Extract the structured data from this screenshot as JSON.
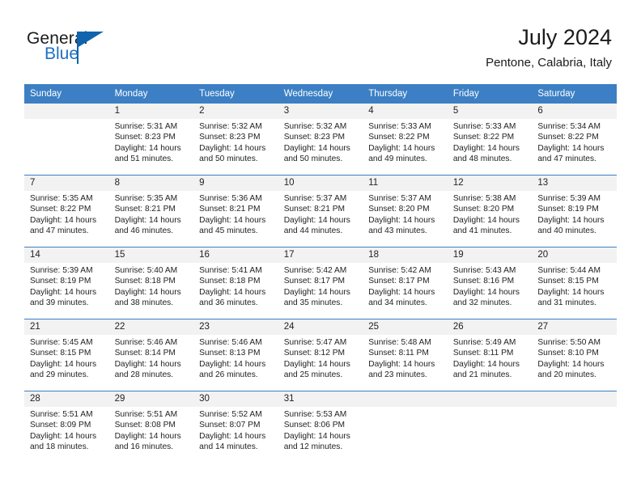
{
  "brand": {
    "word1": "General",
    "word2": "Blue",
    "flag_icon": "flag-triangle-icon",
    "accent_color": "#1063ad"
  },
  "header": {
    "title": "July 2024",
    "subtitle": "Pentone, Calabria, Italy"
  },
  "calendar": {
    "header_bg": "#3c7fc4",
    "daynum_bg": "#f2f2f2",
    "weekdays": [
      "Sunday",
      "Monday",
      "Tuesday",
      "Wednesday",
      "Thursday",
      "Friday",
      "Saturday"
    ],
    "weeks": [
      [
        {
          "day": "",
          "sunrise": "",
          "sunset": "",
          "daylight1": "",
          "daylight2": ""
        },
        {
          "day": "1",
          "sunrise": "Sunrise: 5:31 AM",
          "sunset": "Sunset: 8:23 PM",
          "daylight1": "Daylight: 14 hours",
          "daylight2": "and 51 minutes."
        },
        {
          "day": "2",
          "sunrise": "Sunrise: 5:32 AM",
          "sunset": "Sunset: 8:23 PM",
          "daylight1": "Daylight: 14 hours",
          "daylight2": "and 50 minutes."
        },
        {
          "day": "3",
          "sunrise": "Sunrise: 5:32 AM",
          "sunset": "Sunset: 8:23 PM",
          "daylight1": "Daylight: 14 hours",
          "daylight2": "and 50 minutes."
        },
        {
          "day": "4",
          "sunrise": "Sunrise: 5:33 AM",
          "sunset": "Sunset: 8:22 PM",
          "daylight1": "Daylight: 14 hours",
          "daylight2": "and 49 minutes."
        },
        {
          "day": "5",
          "sunrise": "Sunrise: 5:33 AM",
          "sunset": "Sunset: 8:22 PM",
          "daylight1": "Daylight: 14 hours",
          "daylight2": "and 48 minutes."
        },
        {
          "day": "6",
          "sunrise": "Sunrise: 5:34 AM",
          "sunset": "Sunset: 8:22 PM",
          "daylight1": "Daylight: 14 hours",
          "daylight2": "and 47 minutes."
        }
      ],
      [
        {
          "day": "7",
          "sunrise": "Sunrise: 5:35 AM",
          "sunset": "Sunset: 8:22 PM",
          "daylight1": "Daylight: 14 hours",
          "daylight2": "and 47 minutes."
        },
        {
          "day": "8",
          "sunrise": "Sunrise: 5:35 AM",
          "sunset": "Sunset: 8:21 PM",
          "daylight1": "Daylight: 14 hours",
          "daylight2": "and 46 minutes."
        },
        {
          "day": "9",
          "sunrise": "Sunrise: 5:36 AM",
          "sunset": "Sunset: 8:21 PM",
          "daylight1": "Daylight: 14 hours",
          "daylight2": "and 45 minutes."
        },
        {
          "day": "10",
          "sunrise": "Sunrise: 5:37 AM",
          "sunset": "Sunset: 8:21 PM",
          "daylight1": "Daylight: 14 hours",
          "daylight2": "and 44 minutes."
        },
        {
          "day": "11",
          "sunrise": "Sunrise: 5:37 AM",
          "sunset": "Sunset: 8:20 PM",
          "daylight1": "Daylight: 14 hours",
          "daylight2": "and 43 minutes."
        },
        {
          "day": "12",
          "sunrise": "Sunrise: 5:38 AM",
          "sunset": "Sunset: 8:20 PM",
          "daylight1": "Daylight: 14 hours",
          "daylight2": "and 41 minutes."
        },
        {
          "day": "13",
          "sunrise": "Sunrise: 5:39 AM",
          "sunset": "Sunset: 8:19 PM",
          "daylight1": "Daylight: 14 hours",
          "daylight2": "and 40 minutes."
        }
      ],
      [
        {
          "day": "14",
          "sunrise": "Sunrise: 5:39 AM",
          "sunset": "Sunset: 8:19 PM",
          "daylight1": "Daylight: 14 hours",
          "daylight2": "and 39 minutes."
        },
        {
          "day": "15",
          "sunrise": "Sunrise: 5:40 AM",
          "sunset": "Sunset: 8:18 PM",
          "daylight1": "Daylight: 14 hours",
          "daylight2": "and 38 minutes."
        },
        {
          "day": "16",
          "sunrise": "Sunrise: 5:41 AM",
          "sunset": "Sunset: 8:18 PM",
          "daylight1": "Daylight: 14 hours",
          "daylight2": "and 36 minutes."
        },
        {
          "day": "17",
          "sunrise": "Sunrise: 5:42 AM",
          "sunset": "Sunset: 8:17 PM",
          "daylight1": "Daylight: 14 hours",
          "daylight2": "and 35 minutes."
        },
        {
          "day": "18",
          "sunrise": "Sunrise: 5:42 AM",
          "sunset": "Sunset: 8:17 PM",
          "daylight1": "Daylight: 14 hours",
          "daylight2": "and 34 minutes."
        },
        {
          "day": "19",
          "sunrise": "Sunrise: 5:43 AM",
          "sunset": "Sunset: 8:16 PM",
          "daylight1": "Daylight: 14 hours",
          "daylight2": "and 32 minutes."
        },
        {
          "day": "20",
          "sunrise": "Sunrise: 5:44 AM",
          "sunset": "Sunset: 8:15 PM",
          "daylight1": "Daylight: 14 hours",
          "daylight2": "and 31 minutes."
        }
      ],
      [
        {
          "day": "21",
          "sunrise": "Sunrise: 5:45 AM",
          "sunset": "Sunset: 8:15 PM",
          "daylight1": "Daylight: 14 hours",
          "daylight2": "and 29 minutes."
        },
        {
          "day": "22",
          "sunrise": "Sunrise: 5:46 AM",
          "sunset": "Sunset: 8:14 PM",
          "daylight1": "Daylight: 14 hours",
          "daylight2": "and 28 minutes."
        },
        {
          "day": "23",
          "sunrise": "Sunrise: 5:46 AM",
          "sunset": "Sunset: 8:13 PM",
          "daylight1": "Daylight: 14 hours",
          "daylight2": "and 26 minutes."
        },
        {
          "day": "24",
          "sunrise": "Sunrise: 5:47 AM",
          "sunset": "Sunset: 8:12 PM",
          "daylight1": "Daylight: 14 hours",
          "daylight2": "and 25 minutes."
        },
        {
          "day": "25",
          "sunrise": "Sunrise: 5:48 AM",
          "sunset": "Sunset: 8:11 PM",
          "daylight1": "Daylight: 14 hours",
          "daylight2": "and 23 minutes."
        },
        {
          "day": "26",
          "sunrise": "Sunrise: 5:49 AM",
          "sunset": "Sunset: 8:11 PM",
          "daylight1": "Daylight: 14 hours",
          "daylight2": "and 21 minutes."
        },
        {
          "day": "27",
          "sunrise": "Sunrise: 5:50 AM",
          "sunset": "Sunset: 8:10 PM",
          "daylight1": "Daylight: 14 hours",
          "daylight2": "and 20 minutes."
        }
      ],
      [
        {
          "day": "28",
          "sunrise": "Sunrise: 5:51 AM",
          "sunset": "Sunset: 8:09 PM",
          "daylight1": "Daylight: 14 hours",
          "daylight2": "and 18 minutes."
        },
        {
          "day": "29",
          "sunrise": "Sunrise: 5:51 AM",
          "sunset": "Sunset: 8:08 PM",
          "daylight1": "Daylight: 14 hours",
          "daylight2": "and 16 minutes."
        },
        {
          "day": "30",
          "sunrise": "Sunrise: 5:52 AM",
          "sunset": "Sunset: 8:07 PM",
          "daylight1": "Daylight: 14 hours",
          "daylight2": "and 14 minutes."
        },
        {
          "day": "31",
          "sunrise": "Sunrise: 5:53 AM",
          "sunset": "Sunset: 8:06 PM",
          "daylight1": "Daylight: 14 hours",
          "daylight2": "and 12 minutes."
        },
        {
          "day": "",
          "sunrise": "",
          "sunset": "",
          "daylight1": "",
          "daylight2": ""
        },
        {
          "day": "",
          "sunrise": "",
          "sunset": "",
          "daylight1": "",
          "daylight2": ""
        },
        {
          "day": "",
          "sunrise": "",
          "sunset": "",
          "daylight1": "",
          "daylight2": ""
        }
      ]
    ]
  }
}
